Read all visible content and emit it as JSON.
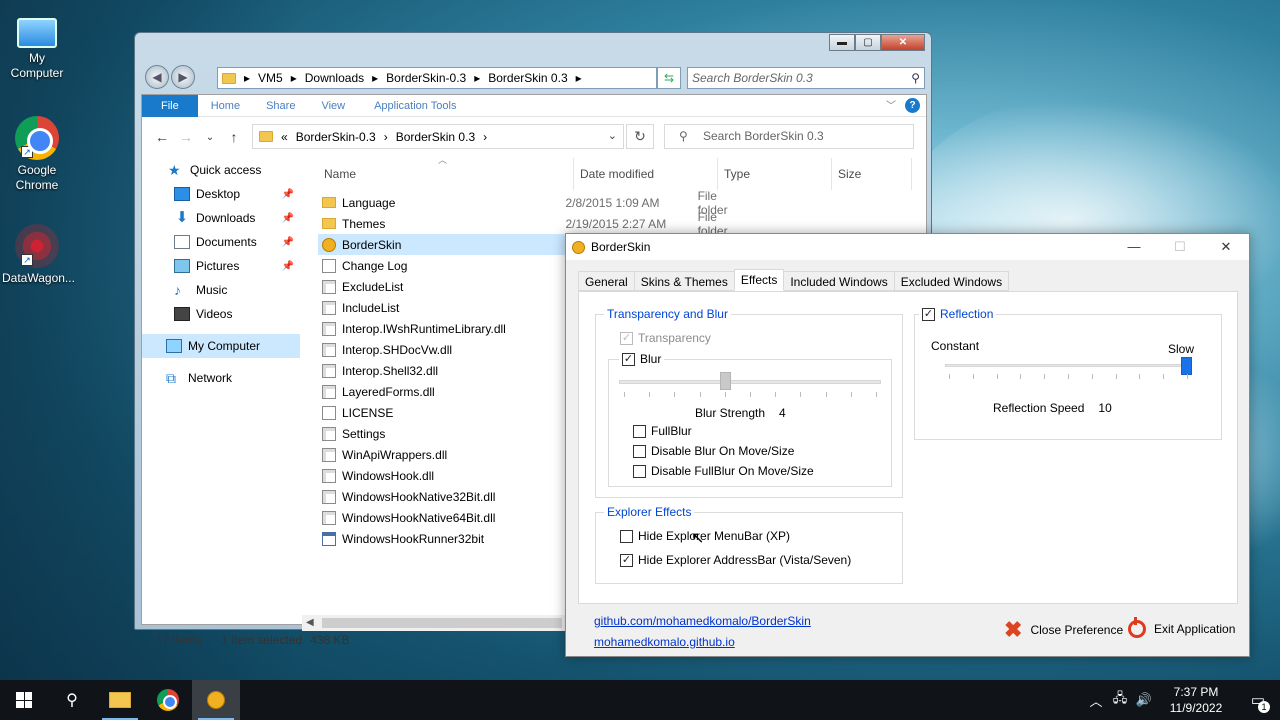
{
  "desktop": {
    "icons": [
      {
        "label": "My Computer",
        "icon": "computer-icon"
      },
      {
        "label": "Google Chrome",
        "icon": "chrome-icon"
      },
      {
        "label": "DataWagon...",
        "icon": "datawagon-icon"
      }
    ]
  },
  "explorer_outer": {
    "caption": {
      "minimize": "▬",
      "maximize": "▢",
      "close": "✕"
    },
    "address_segments": [
      "VM5",
      "Downloads",
      "BorderSkin-0.3",
      "BorderSkin 0.3"
    ],
    "search_placeholder": "Search BorderSkin 0.3"
  },
  "explorer": {
    "ribbon_tabs": [
      "File",
      "Home",
      "Share",
      "View",
      "Application Tools"
    ],
    "address_prefix": "«",
    "address_segments": [
      "BorderSkin-0.3",
      "BorderSkin 0.3"
    ],
    "search_placeholder": "Search BorderSkin 0.3",
    "nav_tree": [
      {
        "label": "Quick access",
        "icon": "star-icon",
        "pinned": false
      },
      {
        "label": "Desktop",
        "icon": "desktop-icon",
        "pinned": true
      },
      {
        "label": "Downloads",
        "icon": "downloads-icon",
        "pinned": true
      },
      {
        "label": "Documents",
        "icon": "documents-icon",
        "pinned": true
      },
      {
        "label": "Pictures",
        "icon": "pictures-icon",
        "pinned": true
      },
      {
        "label": "Music",
        "icon": "music-icon",
        "pinned": false
      },
      {
        "label": "Videos",
        "icon": "videos-icon",
        "pinned": false
      },
      {
        "label": "My Computer",
        "icon": "computer-icon",
        "pinned": false
      },
      {
        "label": "Network",
        "icon": "network-icon",
        "pinned": false
      }
    ],
    "columns": [
      "Name",
      "Date modified",
      "Type",
      "Size"
    ],
    "files": [
      {
        "name": "Language",
        "date": "2/8/2015 1:09 AM",
        "type": "File folder",
        "kind": "folder"
      },
      {
        "name": "Themes",
        "date": "2/19/2015 2:27 AM",
        "type": "File folder",
        "kind": "folder"
      },
      {
        "name": "BorderSkin",
        "date": "",
        "type": "",
        "kind": "app"
      },
      {
        "name": "Change Log",
        "date": "",
        "type": "",
        "kind": "file"
      },
      {
        "name": "ExcludeList",
        "date": "",
        "type": "",
        "kind": "dll"
      },
      {
        "name": "IncludeList",
        "date": "",
        "type": "",
        "kind": "dll"
      },
      {
        "name": "Interop.IWshRuntimeLibrary.dll",
        "date": "",
        "type": "",
        "kind": "dll"
      },
      {
        "name": "Interop.SHDocVw.dll",
        "date": "",
        "type": "",
        "kind": "dll"
      },
      {
        "name": "Interop.Shell32.dll",
        "date": "",
        "type": "",
        "kind": "dll"
      },
      {
        "name": "LayeredForms.dll",
        "date": "",
        "type": "",
        "kind": "dll"
      },
      {
        "name": "LICENSE",
        "date": "",
        "type": "",
        "kind": "file"
      },
      {
        "name": "Settings",
        "date": "",
        "type": "",
        "kind": "dll"
      },
      {
        "name": "WinApiWrappers.dll",
        "date": "",
        "type": "",
        "kind": "dll"
      },
      {
        "name": "WindowsHook.dll",
        "date": "",
        "type": "",
        "kind": "dll"
      },
      {
        "name": "WindowsHookNative32Bit.dll",
        "date": "",
        "type": "",
        "kind": "dll"
      },
      {
        "name": "WindowsHookNative64Bit.dll",
        "date": "",
        "type": "",
        "kind": "dll"
      },
      {
        "name": "WindowsHookRunner32bit",
        "date": "",
        "type": "",
        "kind": "exe"
      }
    ],
    "selected_file": "BorderSkin",
    "status": {
      "items": "17 items",
      "selected": "1 item selected",
      "size": "438 KB"
    }
  },
  "borderskin": {
    "title": "BorderSkin",
    "tabs": [
      "General",
      "Skins & Themes",
      "Effects",
      "Included Windows",
      "Excluded Windows"
    ],
    "active_tab": "Effects",
    "transparency": {
      "group_title": "Transparency and Blur",
      "transparency_label": "Transparency",
      "transparency_checked": true,
      "transparency_disabled": true,
      "blur_label": "Blur",
      "blur_checked": true,
      "blur_strength_label": "Blur Strength",
      "blur_strength_value": "4",
      "blur_strength_max": 10,
      "fullblur_label": "FullBlur",
      "disable_blur_label": "Disable Blur On Move/Size",
      "disable_fullblur_label": "Disable FullBlur On Move/Size"
    },
    "reflection": {
      "label": "Reflection",
      "checked": true,
      "left_label": "Constant",
      "right_label": "Slow",
      "speed_label": "Reflection Speed",
      "speed_value": "10",
      "speed_max": 10
    },
    "explorer_effects": {
      "group_title": "Explorer Effects",
      "hide_menubar_label": "Hide Explorer MenuBar (XP)",
      "hide_menubar_checked": false,
      "hide_addressbar_label": "Hide Explorer AddressBar (Vista/Seven)",
      "hide_addressbar_checked": true
    },
    "links": [
      "github.com/mohamedkomalo/BorderSkin",
      "mohamedkomalo.github.io"
    ],
    "close_pref_label": "Close Preference",
    "exit_app_label": "Exit Application"
  },
  "taskbar": {
    "time": "7:37 PM",
    "date": "11/9/2022",
    "notification_count": "1"
  }
}
